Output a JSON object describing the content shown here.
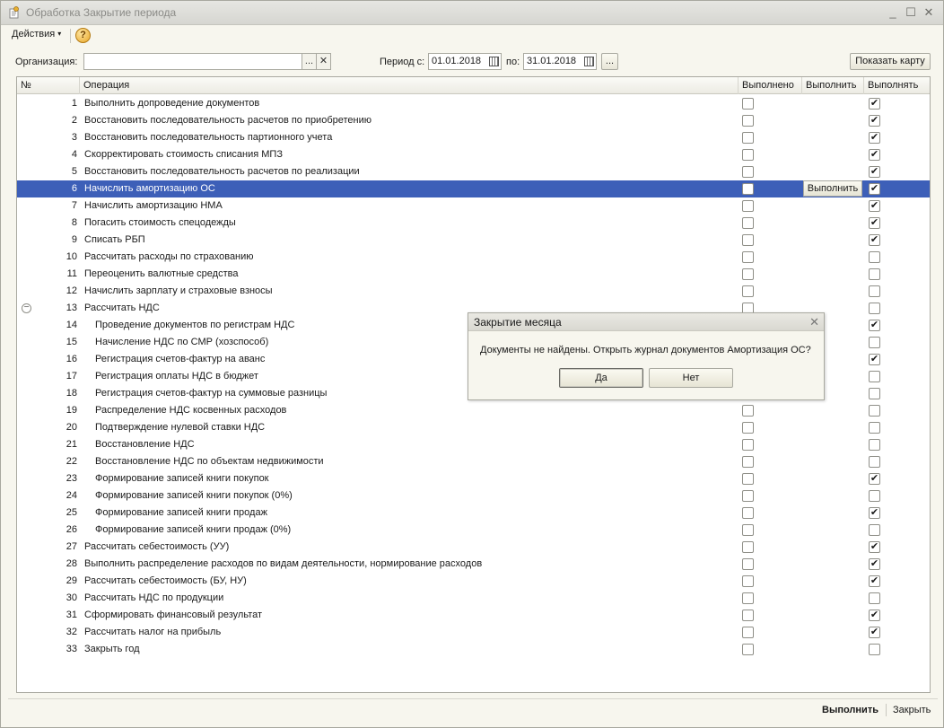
{
  "window": {
    "title": "Обработка  Закрытие периода",
    "minimize": "_",
    "maximize": "☐",
    "close": "✕"
  },
  "toolbar": {
    "actions_label": "Действия",
    "actions_arrow": "▾",
    "help": "?"
  },
  "filters": {
    "org_label": "Организация:",
    "org_value": "",
    "org_select": "...",
    "org_clear": "✕",
    "period_from_label": "Период с:",
    "period_from": "01.01.2018",
    "period_to_label": "по:",
    "period_to": "31.01.2018",
    "period_select": "...",
    "show_map": "Показать карту"
  },
  "table": {
    "headers": [
      "№",
      "Операция",
      "Выполнено",
      "Выполнить",
      "Выполнять"
    ],
    "rows": [
      {
        "num": "1",
        "op": "Выполнить допроведение документов",
        "sub": false,
        "done": false,
        "run": true
      },
      {
        "num": "2",
        "op": "Восстановить последовательность расчетов по приобретению",
        "sub": false,
        "done": false,
        "run": true
      },
      {
        "num": "3",
        "op": "Восстановить последовательность партионного учета",
        "sub": false,
        "done": false,
        "run": true
      },
      {
        "num": "4",
        "op": "Скорректировать стоимость списания МПЗ",
        "sub": false,
        "done": false,
        "run": true
      },
      {
        "num": "5",
        "op": "Восстановить последовательность расчетов по реализации",
        "sub": false,
        "done": false,
        "run": true
      },
      {
        "num": "6",
        "op": "Начислить амортизацию ОС",
        "sub": false,
        "done": false,
        "run": true,
        "selected": true
      },
      {
        "num": "7",
        "op": "Начислить амортизацию НМА",
        "sub": false,
        "done": false,
        "run": true
      },
      {
        "num": "8",
        "op": "Погасить стоимость спецодежды",
        "sub": false,
        "done": false,
        "run": true
      },
      {
        "num": "9",
        "op": "Списать РБП",
        "sub": false,
        "done": false,
        "run": true
      },
      {
        "num": "10",
        "op": "Рассчитать расходы по страхованию",
        "sub": false,
        "done": false,
        "run": false
      },
      {
        "num": "11",
        "op": "Переоценить валютные средства",
        "sub": false,
        "done": false,
        "run": false
      },
      {
        "num": "12",
        "op": "Начислить зарплату и страховые взносы",
        "sub": false,
        "done": false,
        "run": false
      },
      {
        "num": "13",
        "op": "Рассчитать НДС",
        "sub": false,
        "done": false,
        "run": false,
        "group": true
      },
      {
        "num": "14",
        "op": "Проведение документов по регистрам НДС",
        "sub": true,
        "done": false,
        "run": true
      },
      {
        "num": "15",
        "op": "Начисление НДС по СМР (хозспособ)",
        "sub": true,
        "done": false,
        "run": false
      },
      {
        "num": "16",
        "op": "Регистрация счетов-фактур на аванс",
        "sub": true,
        "done": false,
        "run": true
      },
      {
        "num": "17",
        "op": "Регистрация оплаты НДС в бюджет",
        "sub": true,
        "done": false,
        "run": false
      },
      {
        "num": "18",
        "op": "Регистрация счетов-фактур на суммовые разницы",
        "sub": true,
        "done": false,
        "run": false
      },
      {
        "num": "19",
        "op": "Распределение НДС косвенных расходов",
        "sub": true,
        "done": false,
        "run": false
      },
      {
        "num": "20",
        "op": "Подтверждение нулевой ставки НДС",
        "sub": true,
        "done": false,
        "run": false
      },
      {
        "num": "21",
        "op": "Восстановление НДС",
        "sub": true,
        "done": false,
        "run": false
      },
      {
        "num": "22",
        "op": "Восстановление НДС по объектам недвижимости",
        "sub": true,
        "done": false,
        "run": false
      },
      {
        "num": "23",
        "op": "Формирование записей книги покупок",
        "sub": true,
        "done": false,
        "run": true
      },
      {
        "num": "24",
        "op": "Формирование записей книги покупок (0%)",
        "sub": true,
        "done": false,
        "run": false
      },
      {
        "num": "25",
        "op": "Формирование записей книги продаж",
        "sub": true,
        "done": false,
        "run": true
      },
      {
        "num": "26",
        "op": "Формирование записей книги продаж (0%)",
        "sub": true,
        "done": false,
        "run": false
      },
      {
        "num": "27",
        "op": "Рассчитать себестоимость (УУ)",
        "sub": false,
        "done": false,
        "run": true
      },
      {
        "num": "28",
        "op": "Выполнить распределение расходов по видам деятельности, нормирование расходов",
        "sub": false,
        "done": false,
        "run": true
      },
      {
        "num": "29",
        "op": "Рассчитать себестоимость (БУ, НУ)",
        "sub": false,
        "done": false,
        "run": true
      },
      {
        "num": "30",
        "op": "Рассчитать НДС по продукции",
        "sub": false,
        "done": false,
        "run": false
      },
      {
        "num": "31",
        "op": "Сформировать финансовый результат",
        "sub": false,
        "done": false,
        "run": true
      },
      {
        "num": "32",
        "op": "Рассчитать налог на прибыль",
        "sub": false,
        "done": false,
        "run": true
      },
      {
        "num": "33",
        "op": "Закрыть год",
        "sub": false,
        "done": false,
        "run": false
      }
    ],
    "row_run_button": "Выполнить",
    "collapse_symbol": "−"
  },
  "dialog": {
    "title": "Закрытие месяца",
    "close": "✕",
    "message": "Документы не найдены. Открыть журнал  документов Амортизация ОС?",
    "yes": "Да",
    "no": "Нет"
  },
  "footer": {
    "run": "Выполнить",
    "close": "Закрыть"
  },
  "colors": {
    "selection": "#3d5fb8",
    "window_bg": "#f7f6ee"
  }
}
